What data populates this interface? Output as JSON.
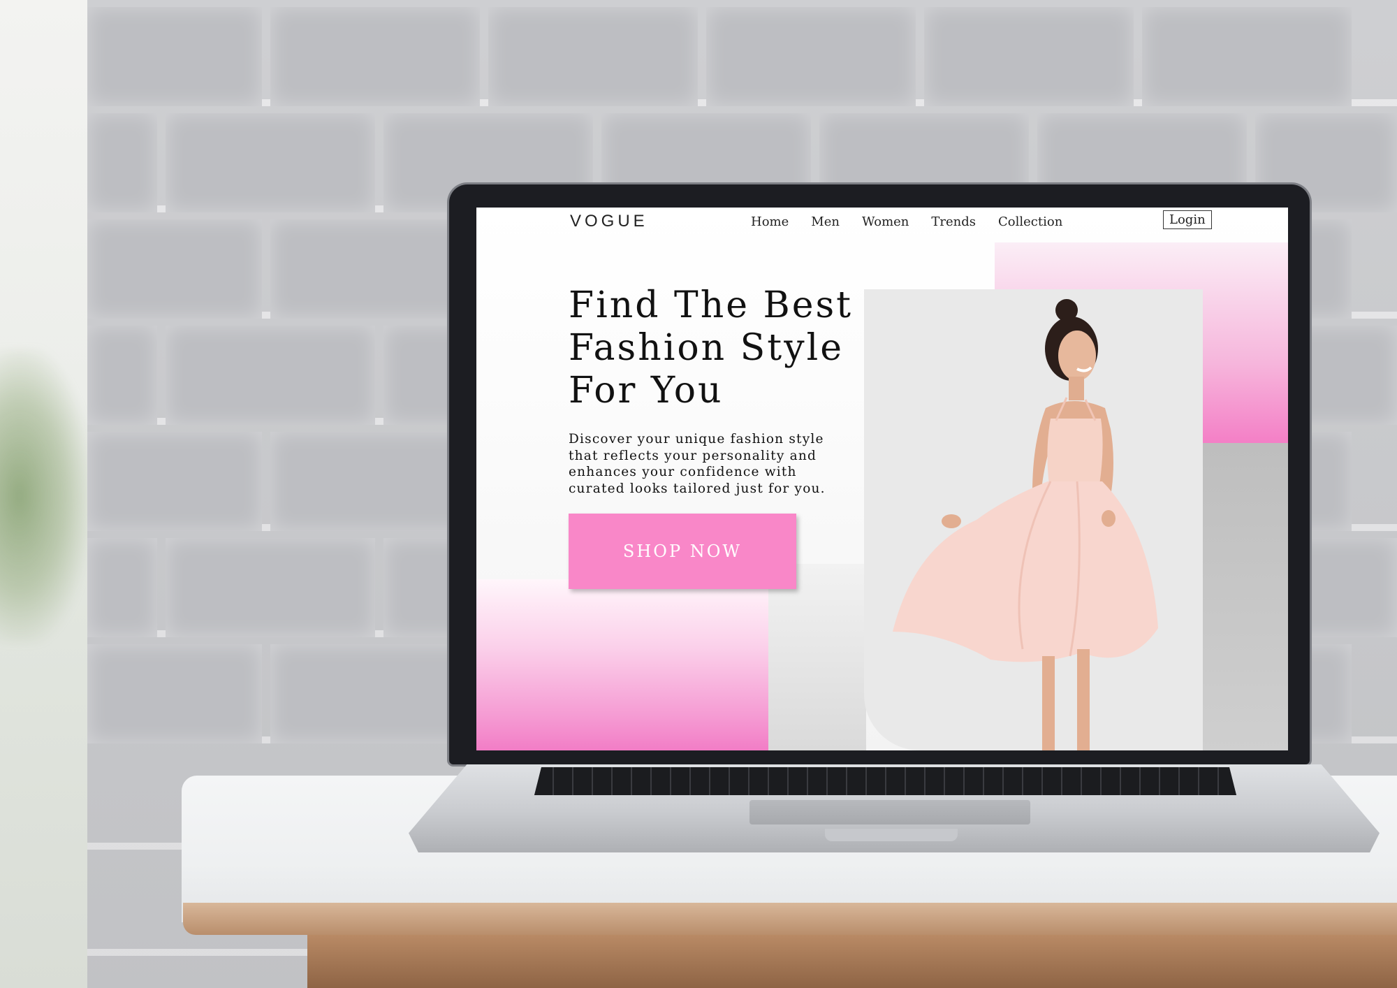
{
  "site": {
    "logo": "VOGUE",
    "nav": [
      "Home",
      "Men",
      "Women",
      "Trends",
      "Collection"
    ],
    "login_label": "Login"
  },
  "hero": {
    "headline_lines": [
      "Find The Best",
      "Fashion Style",
      "For You"
    ],
    "description_lines": [
      "Discover your unique fashion style",
      "that reflects your personality and",
      "enhances your confidence with",
      "curated looks tailored just for you."
    ],
    "cta_label": "SHOP NOW"
  },
  "colors": {
    "accent_pink": "#f987c8",
    "text": "#111111",
    "dress": "#f8d6ce"
  },
  "icons": {
    "model_image": "model-in-pink-dress"
  }
}
